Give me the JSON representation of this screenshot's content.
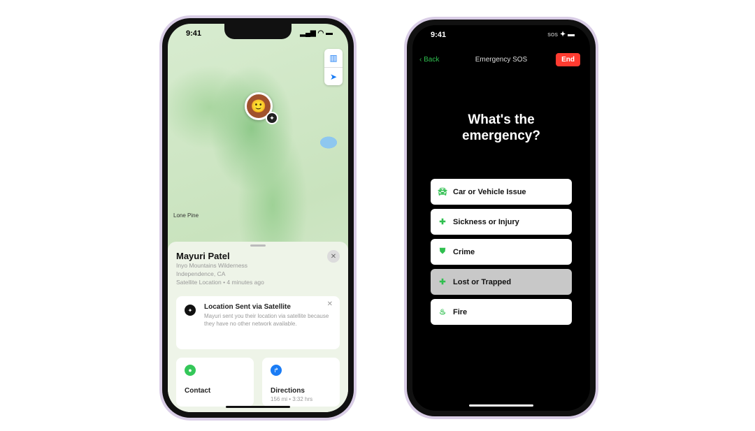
{
  "left_phone": {
    "status": {
      "time": "9:41",
      "icons": "signal wifi battery"
    },
    "map": {
      "place_label": "Lone Pine",
      "buttons": [
        "map-icon",
        "location-arrow-icon"
      ]
    },
    "sheet": {
      "name": "Mayuri Patel",
      "line1": "Inyo Mountains Wilderness",
      "line2": "Independence, CA",
      "line3": "Satellite Location • 4 minutes ago",
      "card": {
        "title": "Location Sent via Satellite",
        "desc": "Mayuri sent you their location via satellite because they have no other network available."
      },
      "actions": [
        {
          "label": "Contact",
          "sub": "",
          "color": "#34c759"
        },
        {
          "label": "Directions",
          "sub": "156 mi • 3:32 hrs",
          "color": "#1a7cf5"
        }
      ]
    }
  },
  "right_phone": {
    "status": {
      "time": "9:41",
      "sos": "SOS"
    },
    "nav": {
      "back": "Back",
      "title": "Emergency SOS",
      "end": "End"
    },
    "question": "What's the emergency?",
    "options": [
      {
        "label": "Car or Vehicle Issue",
        "icon": "car-icon",
        "selected": false
      },
      {
        "label": "Sickness or Injury",
        "icon": "medkit-icon",
        "selected": false
      },
      {
        "label": "Crime",
        "icon": "shield-icon",
        "selected": false
      },
      {
        "label": "Lost or Trapped",
        "icon": "cross-icon",
        "selected": true
      },
      {
        "label": "Fire",
        "icon": "flame-icon",
        "selected": false
      }
    ],
    "accent": "#2fbf4f",
    "end_color": "#ff3b30"
  }
}
